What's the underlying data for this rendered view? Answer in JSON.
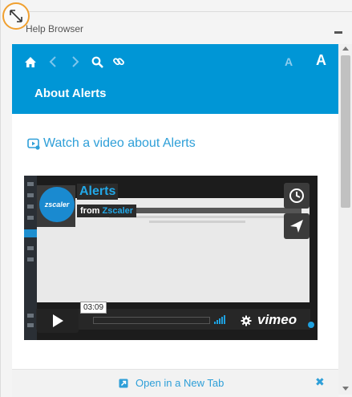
{
  "window": {
    "title": "Help Browser"
  },
  "toolbar": {
    "icons": [
      "home-icon",
      "back-icon",
      "forward-icon",
      "search-icon",
      "link-icon"
    ],
    "font_small": "A",
    "font_large": "A"
  },
  "page": {
    "heading": "About Alerts",
    "video_link": "Watch a video about Alerts"
  },
  "video": {
    "title": "Alerts",
    "byline_from": "from",
    "byline_author": "Zscaler",
    "logo_text": "zscaler",
    "time": "03:09",
    "provider": "vimeo"
  },
  "footer": {
    "open_tab": "Open in a New Tab",
    "close": "✖"
  },
  "colors": {
    "accent": "#0096d6",
    "link": "#2e9fd8",
    "highlight": "#f0a030"
  }
}
